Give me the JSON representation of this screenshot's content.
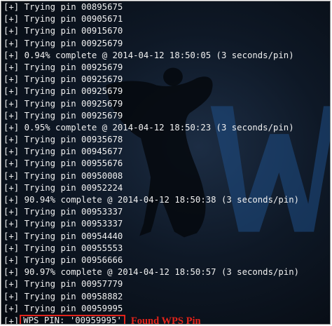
{
  "terminal": {
    "prefix": "[+]",
    "lines": [
      "Trying pin 00895675",
      "Trying pin 00905671",
      "Trying pin 00915670",
      "Trying pin 00925679",
      "0.94% complete @ 2014-04-12 18:50:05 (3 seconds/pin)",
      "Trying pin 00925679",
      "Trying pin 00925679",
      "Trying pin 00925679",
      "Trying pin 00925679",
      "Trying pin 00925679",
      "0.95% complete @ 2014-04-12 18:50:23 (3 seconds/pin)",
      "Trying pin 00935678",
      "Trying pin 00945677",
      "Trying pin 00955676",
      "Trying pin 00950008",
      "Trying pin 00952224",
      "90.94% complete @ 2014-04-12 18:50:38 (3 seconds/pin)",
      "Trying pin 00953337",
      "Trying pin 00953337",
      "Trying pin 00954440",
      "Trying pin 00955553",
      "Trying pin 00956666",
      "90.97% complete @ 2014-04-12 18:50:57 (3 seconds/pin)",
      "Trying pin 00957779",
      "Trying pin 00958882",
      "Trying pin 00959995"
    ],
    "result": "WPS PIN: '00959995'"
  },
  "annotation": {
    "label": "Found WPS Pin",
    "color": "#e2231a"
  },
  "colors": {
    "text": "#f0f0f0",
    "background": "#0e1826",
    "highlight": "#e2231a"
  }
}
